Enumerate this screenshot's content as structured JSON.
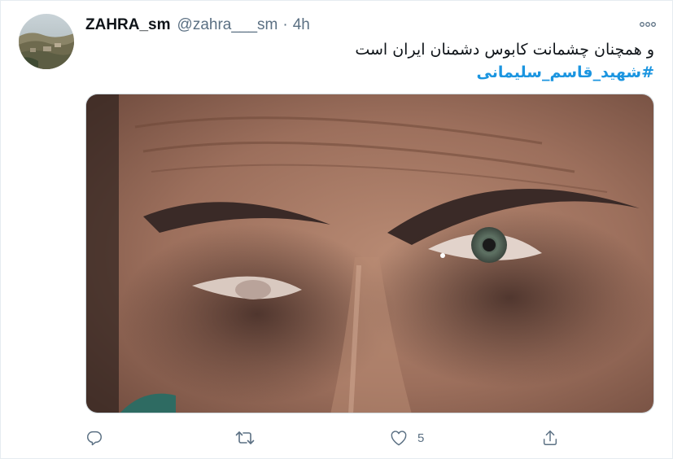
{
  "tweet": {
    "display_name": "ZAHRA_sm",
    "handle": "@zahra___sm",
    "separator": "·",
    "time": "4h",
    "text_line1": "و همچنان چشمانت کابوس دشمنان ایران است",
    "hashtag": "#شهید_قاسم_سلیمانی"
  },
  "actions": {
    "reply_icon": "reply-icon",
    "retweet_icon": "retweet-icon",
    "like_icon": "heart-icon",
    "like_count": "5",
    "share_icon": "share-icon"
  },
  "colors": {
    "link": "#1b95e0",
    "secondary_text": "#5b7083",
    "border": "#e6ecf0"
  }
}
